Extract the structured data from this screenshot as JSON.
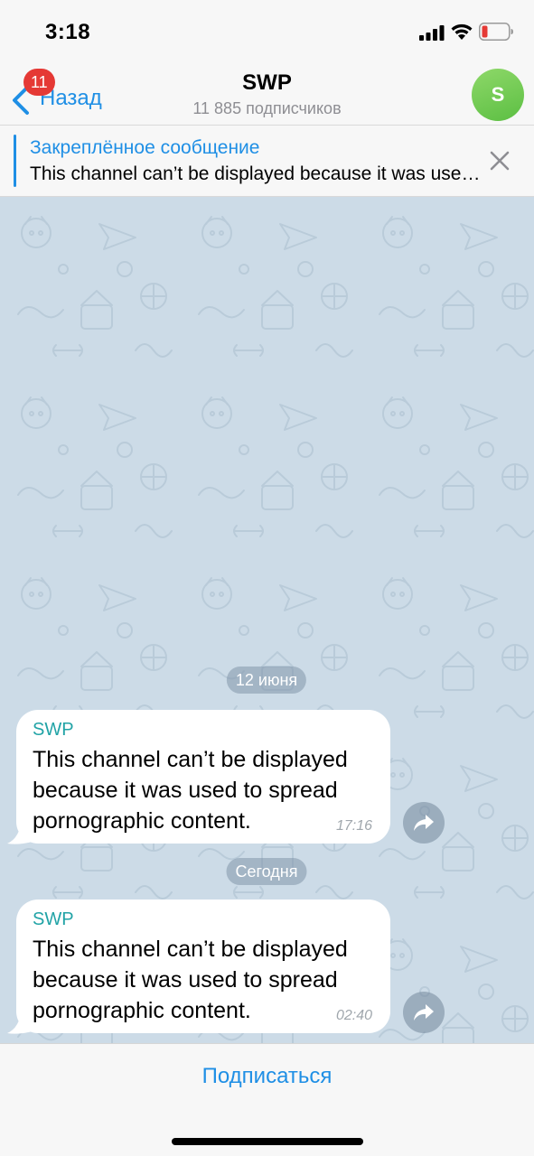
{
  "status_bar": {
    "time": "3:18"
  },
  "nav": {
    "back_badge": "11",
    "back_label": "Назад",
    "title": "SWP",
    "subtitle": "11 885 подписчиков",
    "avatar_letter": "S"
  },
  "pinned": {
    "title": "Закреплённое сообщение",
    "text": "This channel can’t be displayed because it was used to spread pornographic content."
  },
  "chat": {
    "date_1": "12 июня",
    "date_2": "Сегодня",
    "messages": [
      {
        "sender": "SWP",
        "text": "This channel can’t be displayed because it was used to spread pornographic content.",
        "time": "17:16"
      },
      {
        "sender": "SWP",
        "text": "This channel can’t be displayed because it was used to spread pornographic content.",
        "time": "02:40"
      }
    ]
  },
  "bottom": {
    "subscribe_label": "Подписаться"
  },
  "colors": {
    "accent": "#1f8fe5",
    "badge": "#e53935",
    "sender": "#21a3a6",
    "avatar": "#6cc84f",
    "chat_bg": "#ccdbe7"
  },
  "icons": [
    "signal-icon",
    "wifi-icon",
    "battery-icon",
    "back-chevron-icon",
    "close-icon",
    "share-icon"
  ]
}
